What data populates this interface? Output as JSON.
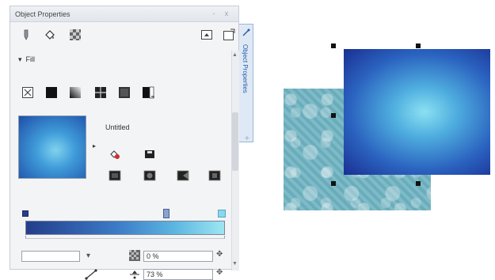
{
  "panel": {
    "title": "Object Properties",
    "title_controls": [
      "-",
      "x"
    ],
    "fill_section_label": "Fill",
    "fill_name": "Untitled",
    "fill_types": [
      "no-fill-icon",
      "uniform-fill-icon",
      "fountain-fill-icon",
      "vector-pattern-fill-icon",
      "bitmap-pattern-fill-icon",
      "texture-fill-icon"
    ],
    "side_tab_label": "Object Properties",
    "first_color_value": "",
    "transparency_value": "0 %",
    "midpoint_value": "73 %"
  },
  "colors": {
    "gradient_start": "#233e8b",
    "gradient_end": "#9ee6f2",
    "accent_tab": "#2a5ea8"
  }
}
